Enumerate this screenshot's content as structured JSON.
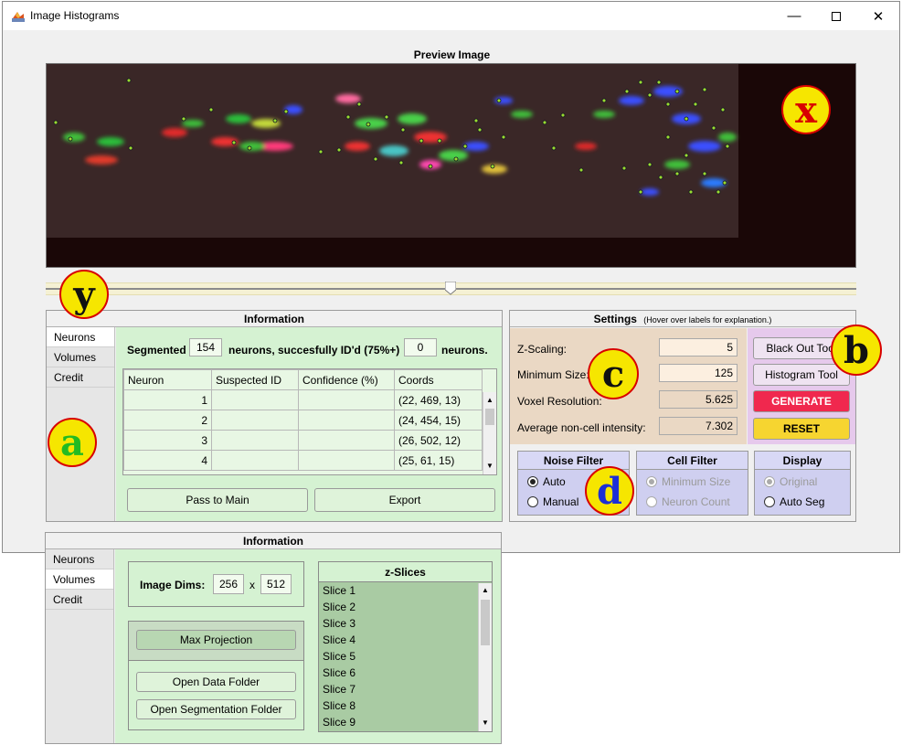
{
  "window": {
    "title": "Image Histograms",
    "minimize_icon": "minimize-icon",
    "maximize_icon": "maximize-icon",
    "close_icon": "close-icon"
  },
  "preview": {
    "title": "Preview Image"
  },
  "info1": {
    "title": "Information",
    "tabs": [
      "Neurons",
      "Volumes",
      "Credit"
    ],
    "active_tab": "Neurons",
    "segmented_label": "Segmented",
    "segmented_count": "154",
    "identified_label": "neurons, succesfully ID'd (75%+)",
    "identified_count": "0",
    "neurons_suffix": "neurons.",
    "columns": [
      "Neuron",
      "Suspected ID",
      "Confidence (%)",
      "Coords"
    ],
    "rows": [
      {
        "neuron": "1",
        "id": "",
        "confidence": "",
        "coords": "(22, 469, 13)"
      },
      {
        "neuron": "2",
        "id": "",
        "confidence": "",
        "coords": "(24, 454, 15)"
      },
      {
        "neuron": "3",
        "id": "",
        "confidence": "",
        "coords": "(26, 502, 12)"
      },
      {
        "neuron": "4",
        "id": "",
        "confidence": "",
        "coords": "(25, 61, 15)"
      }
    ],
    "pass_button": "Pass to Main",
    "export_button": "Export"
  },
  "settings": {
    "title": "Settings",
    "hint": "(Hover over labels for explanation.)",
    "fields": [
      {
        "label": "Z-Scaling:",
        "value": "5"
      },
      {
        "label": "Minimum Size:",
        "value": "125"
      },
      {
        "label": "Voxel Resolution:",
        "value": "5.625"
      },
      {
        "label": "Average non-cell intensity:",
        "value": "7.302"
      }
    ],
    "black_out_button": "Black Out Tool",
    "histogram_button": "Histogram Tool",
    "generate_button": "GENERATE",
    "reset_button": "RESET",
    "noise_filter": {
      "title": "Noise Filter",
      "options": [
        "Auto",
        "Manual"
      ],
      "selected": "Auto"
    },
    "cell_filter": {
      "title": "Cell Filter",
      "options": [
        "Minimum Size",
        "Neuron Count"
      ],
      "selected": "Minimum Size"
    },
    "display": {
      "title": "Display",
      "options": [
        "Original",
        "Auto Seg"
      ],
      "selected": "Original"
    }
  },
  "info2": {
    "title": "Information",
    "tabs": [
      "Neurons",
      "Volumes",
      "Credit"
    ],
    "active_tab": "Volumes",
    "image_dims_label": "Image Dims:",
    "dim_x": "256",
    "dim_sep": "x",
    "dim_y": "512",
    "max_projection_button": "Max Projection",
    "open_data_button": "Open Data Folder",
    "open_seg_button": "Open Segmentation Folder",
    "zslices_title": "z-Slices",
    "slices": [
      "Slice 1",
      "Slice 2",
      "Slice 3",
      "Slice 4",
      "Slice 5",
      "Slice 6",
      "Slice 7",
      "Slice 8",
      "Slice 9"
    ]
  },
  "badges": {
    "a": "a",
    "b": "b",
    "c": "c",
    "d": "d",
    "x": "x",
    "y": "y"
  },
  "colors": {
    "generate": "#f0284e",
    "reset": "#f6d530",
    "badge_fill": "#f6e600",
    "badge_border": "#d80000"
  }
}
